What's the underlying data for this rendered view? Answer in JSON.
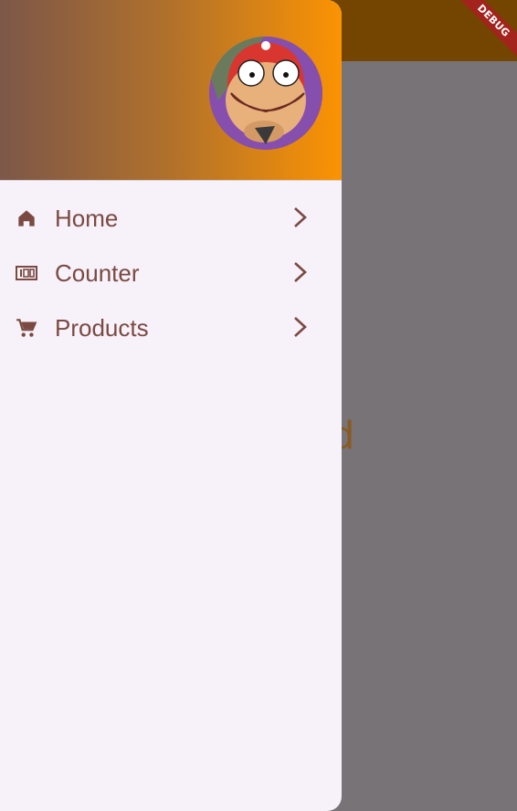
{
  "background": {
    "appbar_color": "#744501",
    "partial_text": "d"
  },
  "debug_banner": {
    "label": "DEBUG"
  },
  "drawer": {
    "header": {
      "gradient_start": "#7d5749",
      "gradient_end": "#fb9303",
      "avatar_icon": "avatar-cartoon-face"
    },
    "items": [
      {
        "label": "Home",
        "icon": "home-icon"
      },
      {
        "label": "Counter",
        "icon": "counter-icon"
      },
      {
        "label": "Products",
        "icon": "cart-icon"
      }
    ],
    "item_color": "#7a4a42"
  }
}
